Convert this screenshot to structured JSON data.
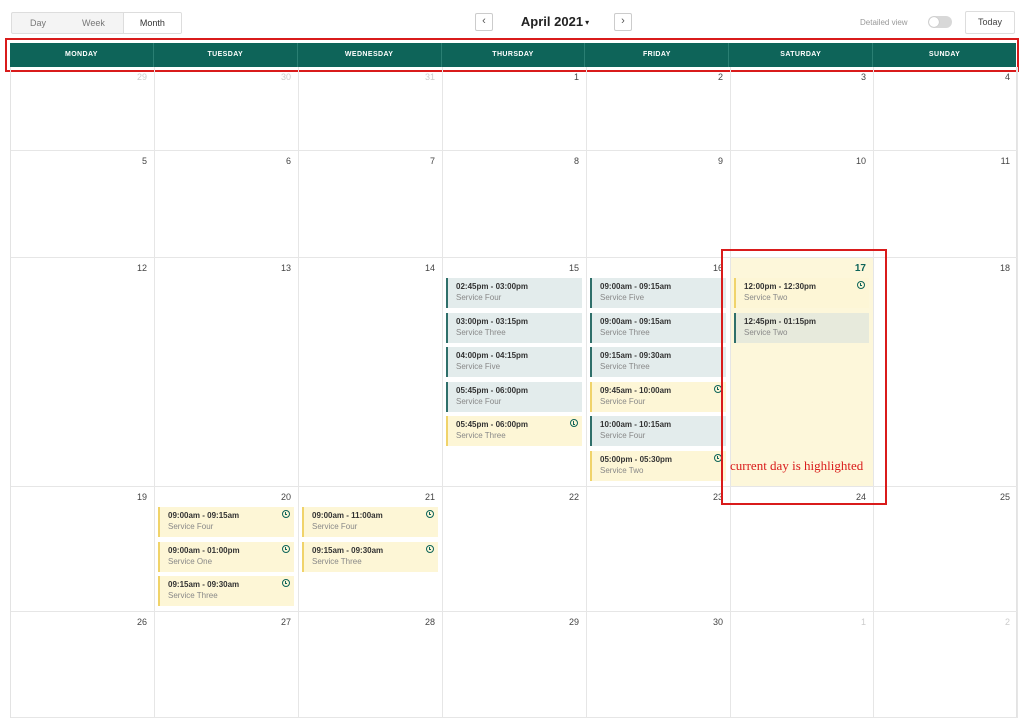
{
  "toolbar": {
    "views": [
      {
        "label": "Day",
        "active": false
      },
      {
        "label": "Week",
        "active": false
      },
      {
        "label": "Month",
        "active": true
      }
    ],
    "prev_icon": "chevron-left-icon",
    "next_icon": "chevron-right-icon",
    "month_title": "April 2021",
    "caret": "▾",
    "detailed_view_label": "Detailed view",
    "detailed_view_on": false,
    "today_label": "Today"
  },
  "weekdays": [
    "MONDAY",
    "TUESDAY",
    "WEDNESDAY",
    "THURSDAY",
    "FRIDAY",
    "SATURDAY",
    "SUNDAY"
  ],
  "colors": {
    "header_bg": "#0e6459",
    "highlight": "#d91b1b",
    "today_bg": "#fdf7da",
    "event_blue": "#e3ecec",
    "event_yellow": "#fdf6d6"
  },
  "weeks": [
    [
      {
        "day": "29",
        "muted": true
      },
      {
        "day": "30",
        "muted": true
      },
      {
        "day": "31",
        "muted": true
      },
      {
        "day": "1",
        "muted": false
      },
      {
        "day": "2",
        "muted": false
      },
      {
        "day": "3",
        "muted": false
      },
      {
        "day": "4",
        "muted": false
      }
    ],
    [
      {
        "day": "5",
        "muted": false
      },
      {
        "day": "6",
        "muted": false
      },
      {
        "day": "7",
        "muted": false
      },
      {
        "day": "8",
        "muted": false
      },
      {
        "day": "9",
        "muted": false
      },
      {
        "day": "10",
        "muted": false
      },
      {
        "day": "11",
        "muted": false
      }
    ],
    [
      {
        "day": "12",
        "muted": false
      },
      {
        "day": "13",
        "muted": false
      },
      {
        "day": "14",
        "muted": false
      },
      {
        "day": "15",
        "muted": false,
        "events": [
          {
            "time": "02:45pm - 03:00pm",
            "service": "Service Four",
            "style": "blue",
            "clock": false
          },
          {
            "time": "03:00pm - 03:15pm",
            "service": "Service Three",
            "style": "blue",
            "clock": false
          },
          {
            "time": "04:00pm - 04:15pm",
            "service": "Service Five",
            "style": "blue",
            "clock": false
          },
          {
            "time": "05:45pm - 06:00pm",
            "service": "Service Four",
            "style": "blue",
            "clock": false
          },
          {
            "time": "05:45pm - 06:00pm",
            "service": "Service Three",
            "style": "yellow",
            "clock": true
          }
        ]
      },
      {
        "day": "16",
        "muted": false,
        "events": [
          {
            "time": "09:00am - 09:15am",
            "service": "Service Five",
            "style": "blue",
            "clock": false
          },
          {
            "time": "09:00am - 09:15am",
            "service": "Service Three",
            "style": "blue",
            "clock": false
          },
          {
            "time": "09:15am - 09:30am",
            "service": "Service Three",
            "style": "blue",
            "clock": false
          },
          {
            "time": "09:45am - 10:00am",
            "service": "Service Four",
            "style": "yellow",
            "clock": true
          },
          {
            "time": "10:00am - 10:15am",
            "service": "Service Four",
            "style": "blue",
            "clock": false
          },
          {
            "time": "05:00pm - 05:30pm",
            "service": "Service Two",
            "style": "yellow",
            "clock": true
          }
        ]
      },
      {
        "day": "17",
        "muted": false,
        "today": true,
        "events": [
          {
            "time": "12:00pm - 12:30pm",
            "service": "Service Two",
            "style": "yellow",
            "clock": true
          },
          {
            "time": "12:45pm - 01:15pm",
            "service": "Service Two",
            "style": "sat-blue",
            "clock": false
          }
        ]
      },
      {
        "day": "18",
        "muted": false
      }
    ],
    [
      {
        "day": "19",
        "muted": false
      },
      {
        "day": "20",
        "muted": false,
        "events": [
          {
            "time": "09:00am - 09:15am",
            "service": "Service Four",
            "style": "yellow",
            "clock": true
          },
          {
            "time": "09:00am - 01:00pm",
            "service": "Service One",
            "style": "yellow",
            "clock": true
          },
          {
            "time": "09:15am - 09:30am",
            "service": "Service Three",
            "style": "yellow",
            "clock": true
          }
        ]
      },
      {
        "day": "21",
        "muted": false,
        "events": [
          {
            "time": "09:00am - 11:00am",
            "service": "Service Four",
            "style": "yellow",
            "clock": true
          },
          {
            "time": "09:15am - 09:30am",
            "service": "Service Three",
            "style": "yellow",
            "clock": true
          }
        ]
      },
      {
        "day": "22",
        "muted": false
      },
      {
        "day": "23",
        "muted": false
      },
      {
        "day": "24",
        "muted": false
      },
      {
        "day": "25",
        "muted": false
      }
    ],
    [
      {
        "day": "26",
        "muted": false
      },
      {
        "day": "27",
        "muted": false
      },
      {
        "day": "28",
        "muted": false
      },
      {
        "day": "29",
        "muted": false
      },
      {
        "day": "30",
        "muted": false
      },
      {
        "day": "1",
        "muted": true
      },
      {
        "day": "2",
        "muted": true
      }
    ]
  ],
  "annotation": "current day is highlighted"
}
